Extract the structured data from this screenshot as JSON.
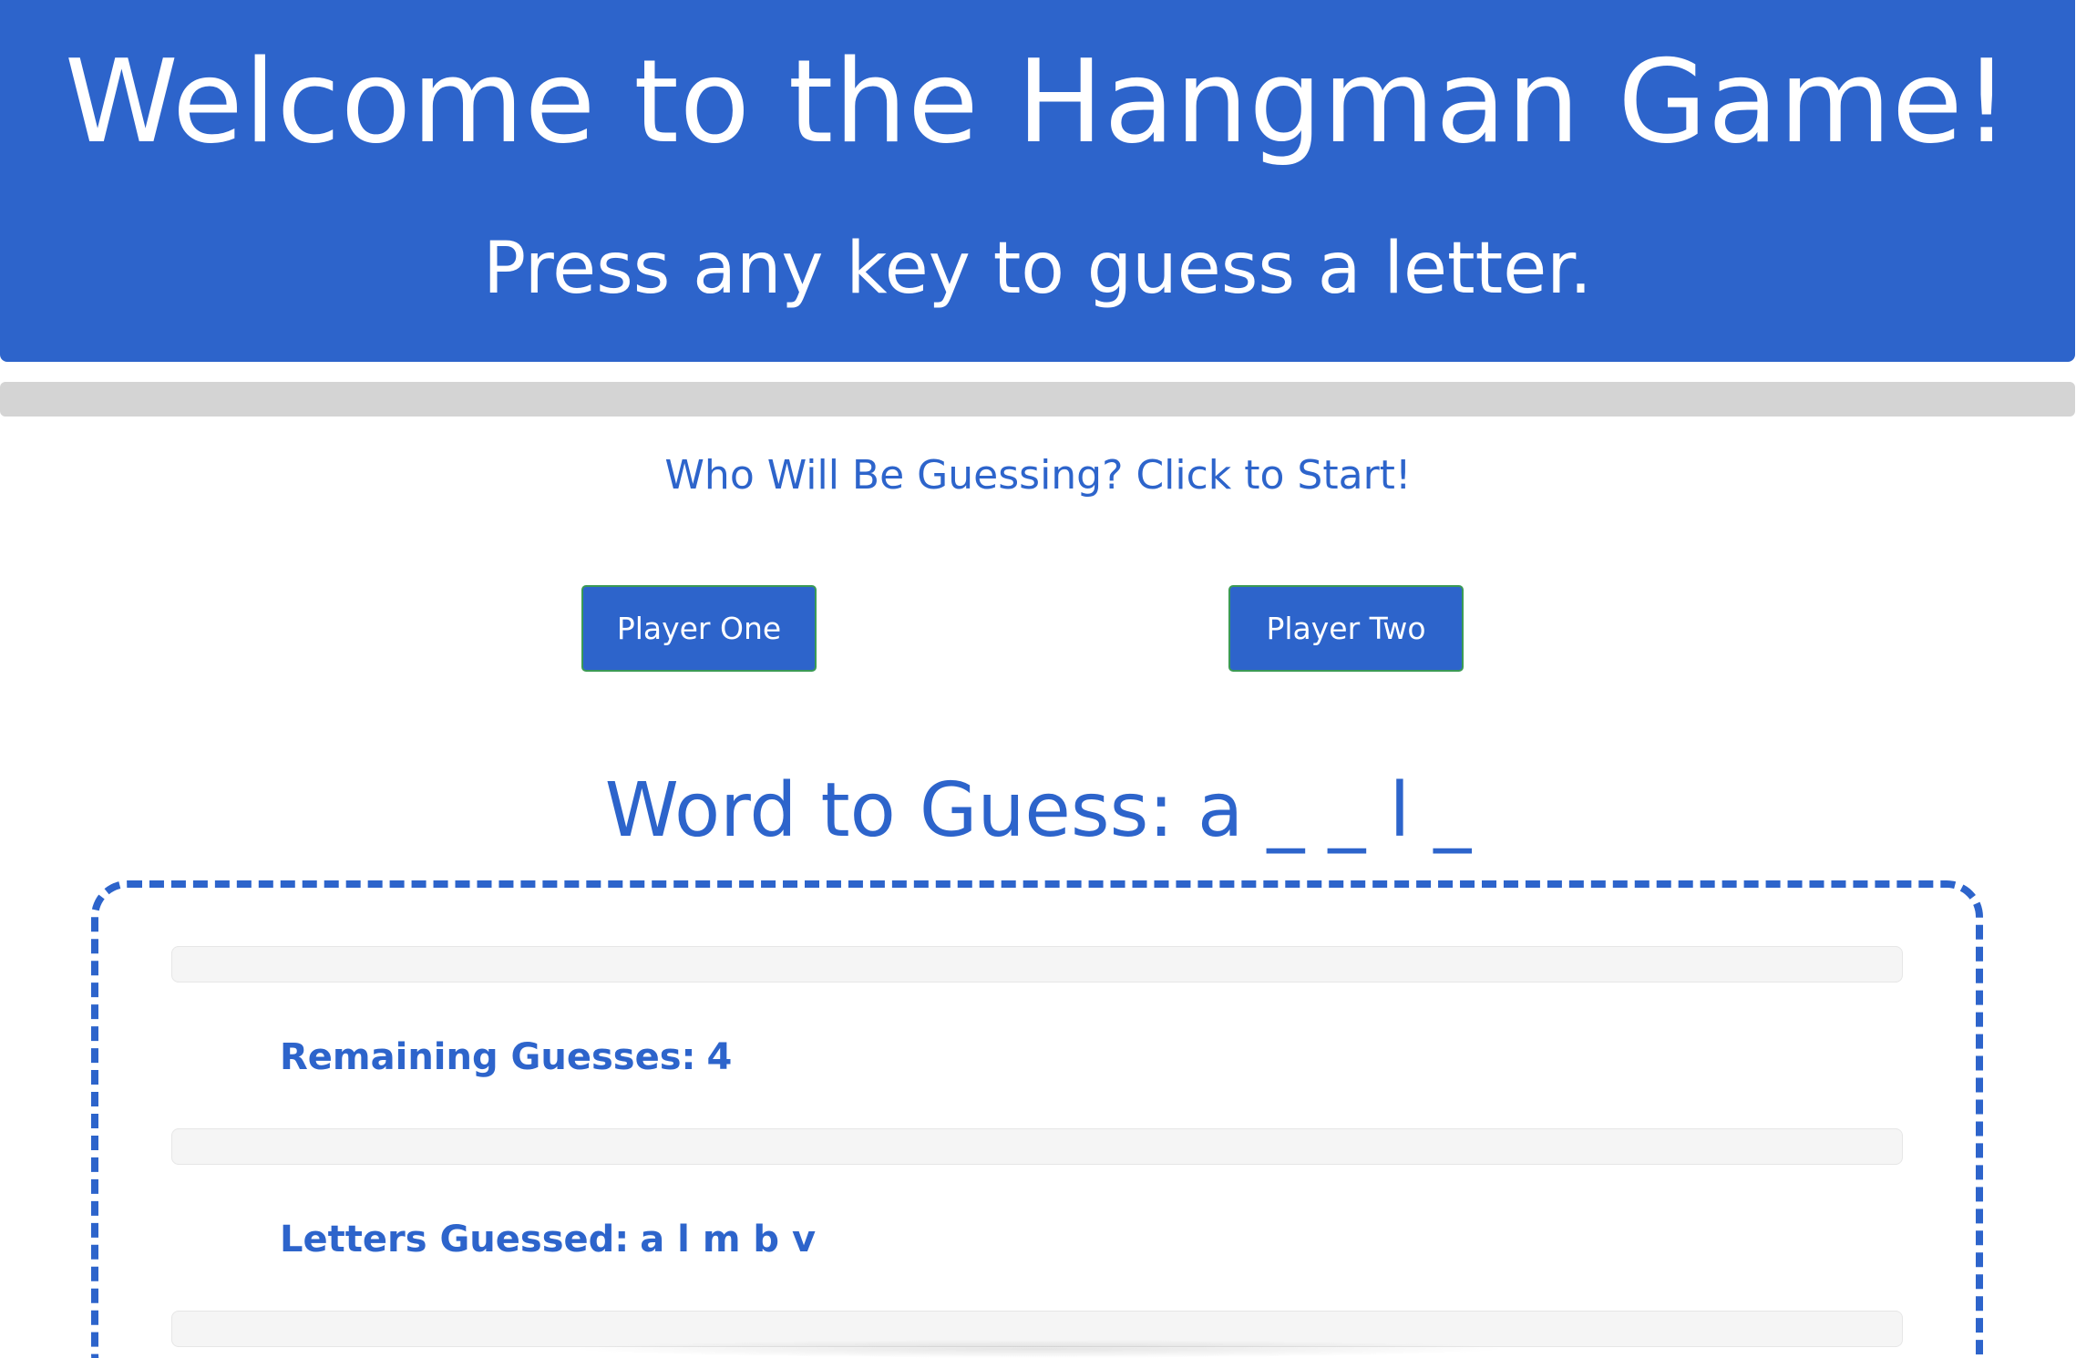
{
  "header": {
    "title": "Welcome to the Hangman Game!",
    "subtitle": "Press any key to guess a letter."
  },
  "prompt": "Who Will Be Guessing? Click to Start!",
  "players": {
    "one_label": "Player One",
    "two_label": "Player Two"
  },
  "word": {
    "label": "Word to Guess:",
    "display": "a _ _ l _"
  },
  "stats": {
    "remaining_label": "Remaining Guesses:",
    "remaining_value": "4",
    "letters_label": "Letters Guessed:",
    "letters_value": "a l m b v"
  },
  "colors": {
    "accent": "#2d64cb",
    "button_border": "#3b9a55",
    "divider": "#d4d4d4",
    "well": "#f5f5f5"
  }
}
